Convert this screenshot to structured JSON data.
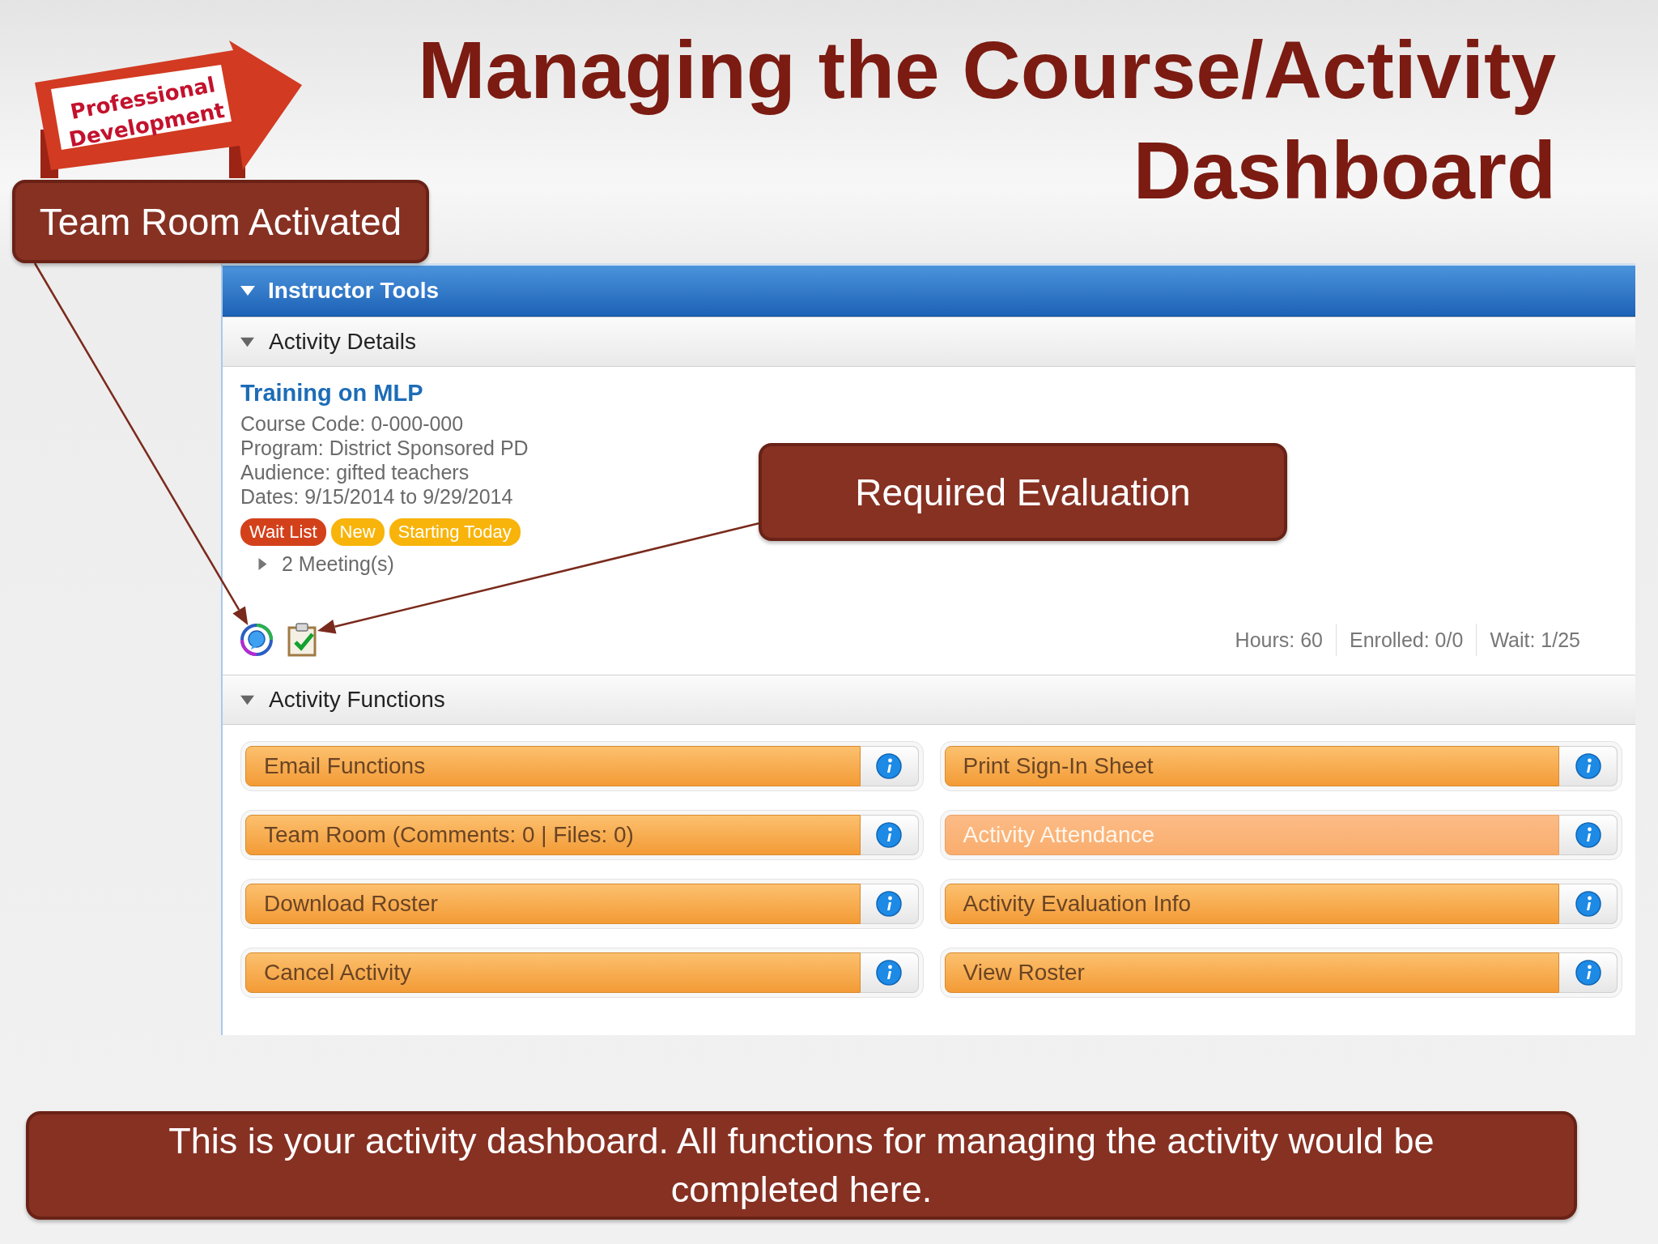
{
  "slide": {
    "title_lines": [
      "Managing the Course/Activity",
      "Dashboard"
    ],
    "logo_lines": [
      "Professional",
      "Development"
    ]
  },
  "callouts": [
    {
      "kind": "top-left",
      "text": "Team Room Activated"
    },
    {
      "kind": "floating",
      "text": "Required Evaluation"
    }
  ],
  "instructor_tools": {
    "title": "Instructor Tools",
    "expanded": true
  },
  "activity_details": {
    "heading": "Activity Details",
    "expanded": true,
    "course_title": "Training on MLP",
    "info_lines": [
      "Course Code: 0-000-000",
      "Program: District Sponsored PD",
      "Audience: gifted teachers",
      "Dates: 9/15/2014 to 9/29/2014"
    ],
    "badges": [
      {
        "label": "Wait List",
        "color": "#d3411b"
      },
      {
        "label": "New",
        "color": "#f8b40a"
      },
      {
        "label": "Starting Today",
        "color": "#f8b40a"
      }
    ],
    "meetings": {
      "label": "2 Meeting(s)",
      "expanded": false
    },
    "stats": [
      "Hours: 60",
      "Enrolled: 0/0",
      "Wait: 1/25"
    ]
  },
  "activity_functions": {
    "heading": "Activity Functions",
    "expanded": true,
    "buttons": [
      {
        "label": "Email Functions",
        "disabled": false
      },
      {
        "label": "Print Sign-In Sheet",
        "disabled": false
      },
      {
        "label": "Team Room (Comments: 0 | Files: 0)",
        "disabled": false
      },
      {
        "label": "Activity Attendance",
        "disabled": true
      },
      {
        "label": "Download Roster",
        "disabled": false
      },
      {
        "label": "Activity Evaluation Info",
        "disabled": false
      },
      {
        "label": "Cancel Activity",
        "disabled": false
      },
      {
        "label": "View Roster",
        "disabled": false
      }
    ]
  },
  "caption": "This is your activity dashboard. All functions for managing the activity would be completed here."
}
